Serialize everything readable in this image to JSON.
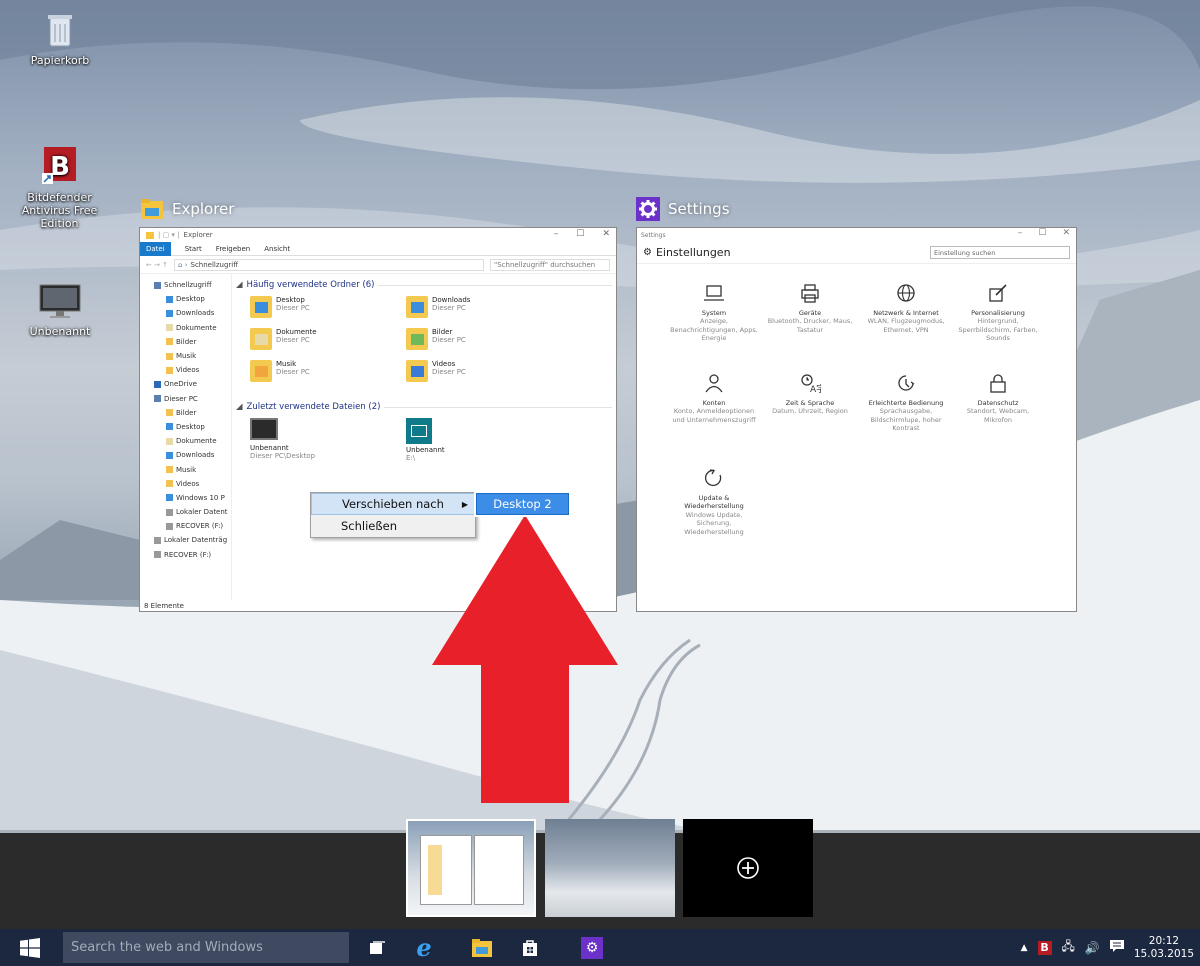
{
  "desktop": {
    "icons": [
      {
        "label": "Papierkorb",
        "icon": "recycle-bin-icon"
      },
      {
        "label": "Bitdefender Antivirus Free Edition",
        "icon": "bitdefender-icon"
      },
      {
        "label": "Unbenannt",
        "icon": "monitor-image-icon"
      }
    ]
  },
  "taskview": {
    "windows": [
      {
        "title": "Explorer",
        "icon": "file-explorer-icon"
      },
      {
        "title": "Settings",
        "icon": "gear-icon"
      }
    ]
  },
  "explorer": {
    "titlebar": "Explorer",
    "ribbon_tabs": [
      "Datei",
      "Start",
      "Freigeben",
      "Ansicht"
    ],
    "breadcrumb": "Schnellzugriff",
    "search_placeholder": "\"Schnellzugriff\" durchsuchen",
    "nav_items": [
      {
        "label": "Schnellzugriff",
        "level": 1,
        "color": "#5a7fb0"
      },
      {
        "label": "Desktop",
        "level": 2,
        "color": "#3b8ede"
      },
      {
        "label": "Downloads",
        "level": 2,
        "color": "#3b8ede"
      },
      {
        "label": "Dokumente",
        "level": 2,
        "color": "#e8d9a8"
      },
      {
        "label": "Bilder",
        "level": 2,
        "color": "#f2c14f"
      },
      {
        "label": "Musik",
        "level": 2,
        "color": "#f2c14f"
      },
      {
        "label": "Videos",
        "level": 2,
        "color": "#f2c14f"
      },
      {
        "label": "OneDrive",
        "level": 1,
        "color": "#2a6ab8"
      },
      {
        "label": "Dieser PC",
        "level": 1,
        "color": "#5a7fb0"
      },
      {
        "label": "Bilder",
        "level": 2,
        "color": "#f2c14f"
      },
      {
        "label": "Desktop",
        "level": 2,
        "color": "#3b8ede"
      },
      {
        "label": "Dokumente",
        "level": 2,
        "color": "#e8d9a8"
      },
      {
        "label": "Downloads",
        "level": 2,
        "color": "#3b8ede"
      },
      {
        "label": "Musik",
        "level": 2,
        "color": "#f2c14f"
      },
      {
        "label": "Videos",
        "level": 2,
        "color": "#f2c14f"
      },
      {
        "label": "Windows 10 P",
        "level": 2,
        "color": "#3b8ede"
      },
      {
        "label": "Lokaler Datent",
        "level": 2,
        "color": "#999999"
      },
      {
        "label": "RECOVER (F:)",
        "level": 2,
        "color": "#999999"
      },
      {
        "label": "Lokaler Datenträg",
        "level": 1,
        "color": "#999999"
      },
      {
        "label": "RECOVER (F:)",
        "level": 1,
        "color": "#999999"
      }
    ],
    "group_frequent": "Häufig verwendete Ordner (6)",
    "frequent": [
      {
        "name": "Desktop",
        "sub": "Dieser PC"
      },
      {
        "name": "Downloads",
        "sub": "Dieser PC"
      },
      {
        "name": "Dokumente",
        "sub": "Dieser PC"
      },
      {
        "name": "Bilder",
        "sub": "Dieser PC"
      },
      {
        "name": "Musik",
        "sub": "Dieser PC"
      },
      {
        "name": "Videos",
        "sub": "Dieser PC"
      }
    ],
    "group_recent": "Zuletzt verwendete Dateien (2)",
    "recent": [
      {
        "name": "Unbenannt",
        "sub": "Dieser PC\\Desktop"
      },
      {
        "name": "Unbenannt",
        "sub": "E:\\"
      }
    ],
    "status": "8 Elemente"
  },
  "settings": {
    "titlebar": "Settings",
    "header": "Einstellungen",
    "search_placeholder": "Einstellung suchen",
    "items": [
      {
        "name": "System",
        "desc": "Anzeige, Benachrichtigungen, Apps, Energie",
        "icon": "laptop-icon"
      },
      {
        "name": "Geräte",
        "desc": "Bluetooth, Drucker, Maus, Tastatur",
        "icon": "printer-icon"
      },
      {
        "name": "Netzwerk & Internet",
        "desc": "WLAN, Flugzeugmodus, Ethernet, VPN",
        "icon": "globe-icon"
      },
      {
        "name": "Personalisierung",
        "desc": "Hintergrund, Sperrbildschirm, Farben, Sounds",
        "icon": "paintbrush-icon"
      },
      {
        "name": "Konten",
        "desc": "Konto, Anmeldeoptionen und Unternehmenszugriff",
        "icon": "person-icon"
      },
      {
        "name": "Zeit & Sprache",
        "desc": "Datum, Uhrzeit, Region",
        "icon": "time-language-icon"
      },
      {
        "name": "Erleichterte Bedienung",
        "desc": "Sprachausgabe, Bildschirmlupe, hoher Kontrast",
        "icon": "ease-of-access-icon"
      },
      {
        "name": "Datenschutz",
        "desc": "Standort, Webcam, Mikrofon",
        "icon": "lock-icon"
      },
      {
        "name": "Update & Wiederherstellung",
        "desc": "Windows Update, Sicherung, Wiederherstellung",
        "icon": "refresh-icon"
      }
    ]
  },
  "context_menu": {
    "items": [
      "Verschieben nach",
      "Schließen"
    ],
    "submenu": [
      "Desktop 2"
    ]
  },
  "taskbar": {
    "search_placeholder": "Search the web and Windows",
    "pinned": [
      "task-view-icon",
      "edge-icon",
      "file-explorer-icon",
      "store-icon",
      "settings-icon"
    ],
    "clock_time": "20:12",
    "clock_date": "15.03.2015"
  },
  "colors": {
    "accent": "#3c8de8",
    "taskbar": "#1c2740",
    "arrow": "#e8202a",
    "settings_purple": "#6b31c9"
  }
}
